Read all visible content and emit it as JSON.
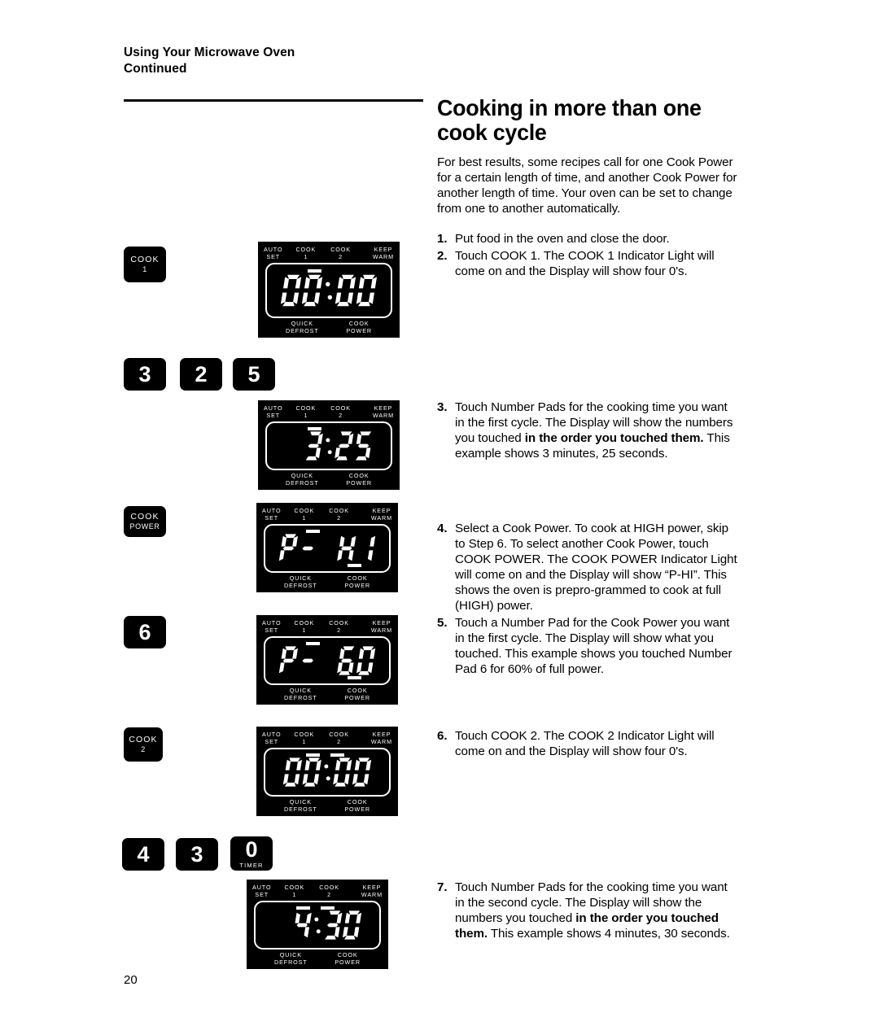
{
  "running_head": {
    "line1": "Using Your Microwave Oven",
    "line2": "Continued"
  },
  "headline": "Cooking in more than one cook cycle",
  "intro": "For best results, some recipes call for one Cook Power for a certain length of time, and another Cook Power for another length of time. Your oven can be set to change from one to another automatically.",
  "steps": [
    {
      "number": "1.",
      "text": "Put food in the oven and close the door."
    },
    {
      "number": "2.",
      "text": "Touch COOK 1. The COOK 1 Indicator Light will come on and the Display will show four 0's."
    },
    {
      "number": "3.",
      "text_before": "Touch Number Pads for the cooking time you want in the first cycle. The Display will show the numbers you touched ",
      "bold": "in the order you touched them.",
      "text_after": " This example shows 3 minutes, 25 seconds."
    },
    {
      "number": "4.",
      "text": "Select a Cook Power. To cook at HIGH power, skip to Step 6. To select another Cook Power, touch COOK POWER. The COOK POWER Indicator Light will come on and the Display will show “P-HI”. This shows the oven is prepro-grammed to cook at full (HIGH) power."
    },
    {
      "number": "5.",
      "text": "Touch a Number Pad for the Cook Power you want in the first cycle. The Display will show what you touched. This example shows you touched Number Pad 6 for 60% of full power."
    },
    {
      "number": "6.",
      "text": "Touch COOK 2. The COOK 2 Indicator Light will come on and the Display will show four 0's."
    },
    {
      "number": "7.",
      "text_before": "Touch Number Pads for the cooking time you want in the second cycle. The Display will show the numbers you touched ",
      "bold": "in the order you touched them.",
      "text_after": " This example shows 4 minutes, 30 seconds."
    }
  ],
  "keys": {
    "cook1": {
      "main": "COOK",
      "sub": "1"
    },
    "pad3": {
      "digit": "3"
    },
    "pad2": {
      "digit": "2"
    },
    "pad5": {
      "digit": "5"
    },
    "cook_power": {
      "main": "COOK",
      "sub": "POWER"
    },
    "pad6": {
      "digit": "6"
    },
    "cook2": {
      "main": "COOK",
      "sub": "2"
    },
    "pad4": {
      "digit": "4"
    },
    "pad3b": {
      "digit": "3"
    },
    "pad0": {
      "digit": "0",
      "sub": "TIMER"
    }
  },
  "panel_labels": {
    "auto_set": "AUTO\nSET",
    "cook1": "COOK\n1",
    "cook2": "COOK\n2",
    "keep_warm": "KEEP\nWARM",
    "quick_defrost": "QUICK\nDEFROST",
    "cook_power": "COOK\nPOWER"
  },
  "displays": [
    {
      "id": "display-00-00",
      "readout": "00:00",
      "colon": true,
      "indicators": {
        "cook1": true,
        "cook2": false,
        "cook_power": false
      }
    },
    {
      "id": "display-3-25",
      "readout": " 3:25",
      "colon": true,
      "indicators": {
        "cook1": true,
        "cook2": false,
        "cook_power": false
      }
    },
    {
      "id": "display-p-hi",
      "readout": "P- HI",
      "colon": false,
      "indicators": {
        "cook1": true,
        "cook2": false,
        "cook_power": true
      }
    },
    {
      "id": "display-p-60",
      "readout": "P- 60",
      "colon": false,
      "indicators": {
        "cook1": true,
        "cook2": false,
        "cook_power": true
      }
    },
    {
      "id": "display-00-00-b",
      "readout": "00:00",
      "colon": true,
      "indicators": {
        "cook1": true,
        "cook2": true,
        "cook_power": false
      }
    },
    {
      "id": "display-4-30",
      "readout": " 4:30",
      "colon": true,
      "indicators": {
        "cook1": true,
        "cook2": true,
        "cook_power": false
      }
    }
  ],
  "page_number": "20",
  "colors": {
    "ink": "#000000",
    "paper": "#ffffff"
  }
}
